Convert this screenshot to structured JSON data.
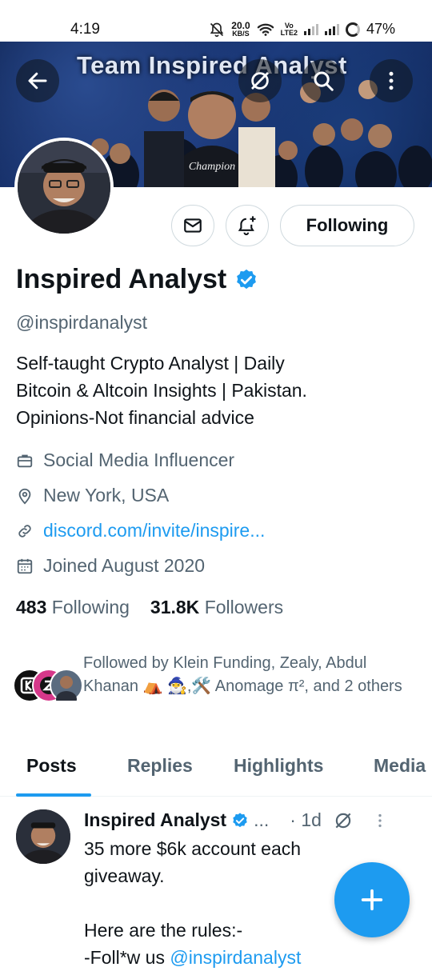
{
  "status_bar": {
    "time": "4:19",
    "speed_value": "20.0",
    "speed_unit": "KB/S",
    "volte_top": "Vo",
    "volte_bottom": "LTE2",
    "battery": "47%"
  },
  "banner": {
    "title": "Team Inspired Analyst"
  },
  "profile": {
    "name": "Inspired Analyst",
    "handle": "@inspirdanalyst",
    "bio": [
      "Self-taught Crypto Analyst | Daily",
      "Bitcoin & Altcoin Insights | Pakistan.",
      "Opinions-Not financial advice"
    ],
    "category": "Social Media Influencer",
    "location": "New York, USA",
    "website": "discord.com/invite/inspire...",
    "joined": "Joined August 2020",
    "following_count": "483",
    "following_label": "Following",
    "followers_count": "31.8K",
    "followers_label": "Followers",
    "followed_by": "Followed by Klein Funding, Zealy, Abdul Khanan ⛺ 🧙‍♂️,🛠️ Anomage π², and 2 others"
  },
  "actions": {
    "following_button": "Following"
  },
  "tabs": [
    {
      "label": "Posts"
    },
    {
      "label": "Replies"
    },
    {
      "label": "Highlights"
    },
    {
      "label": "Media"
    }
  ],
  "post": {
    "author": "Inspired Analyst",
    "ellipsis": "...",
    "time": "· 1d",
    "lines": [
      "35 more $6k account each",
      "giveaway.",
      "",
      "Here are the rules:-"
    ],
    "line5_prefix": "-Foll*w us ",
    "mention": "@inspirdanalyst"
  },
  "colors": {
    "accent": "#1d9bf0",
    "text": "#0f1419",
    "secondary": "#536471",
    "banner": "#1d3a7d"
  }
}
